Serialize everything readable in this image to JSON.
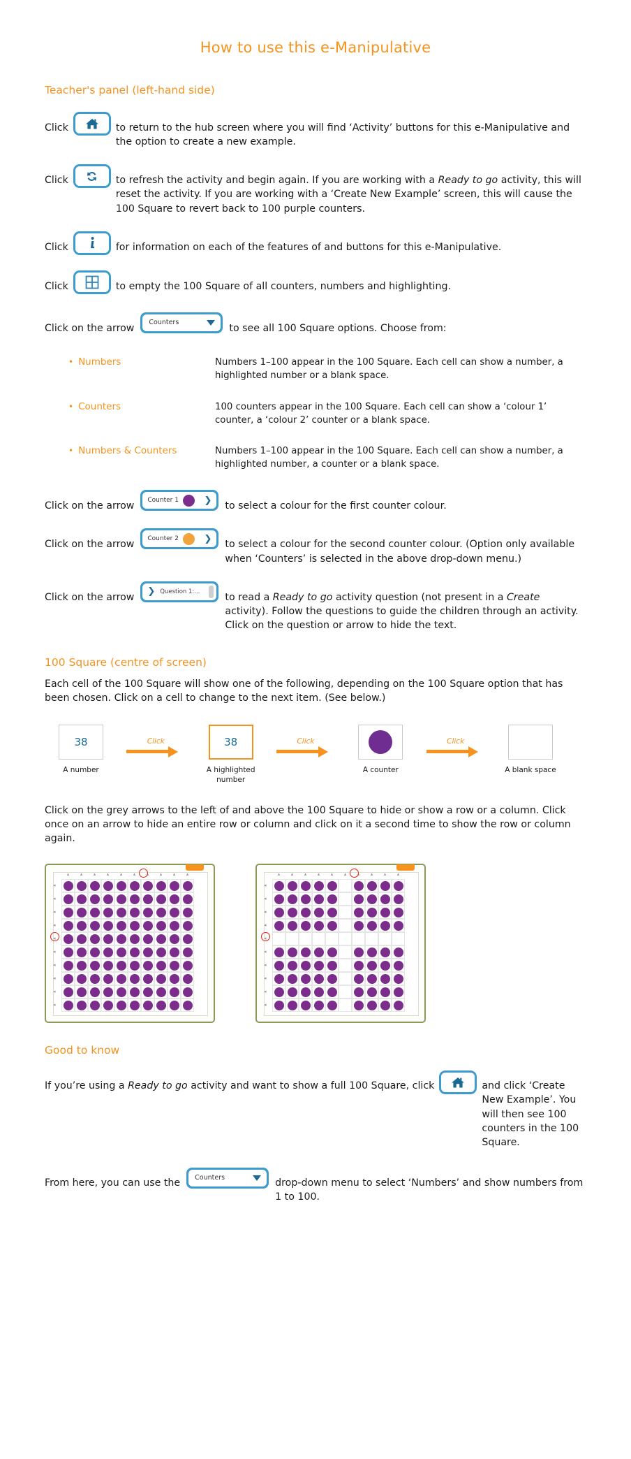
{
  "title": "How to use this e-Manipulative",
  "sections": {
    "teacher_panel": "Teacher's panel (left-hand side)",
    "hundred_square": "100 Square (centre of screen)",
    "good_to_know": "Good to know"
  },
  "colors": {
    "accent_orange": "#f6921e",
    "button_blue": "#3d9ccd",
    "icon_blue": "#1b6a96",
    "counter_purple": "#7c2d8c",
    "counter_orange": "#f2a33c",
    "highlight_red": "#e2231a"
  },
  "rows": {
    "home": {
      "lead": "Click",
      "icon": "home-icon",
      "after": "to return to the hub screen where you will find ‘Activity’ buttons for this e-Manipulative and the option to create a new example."
    },
    "refresh": {
      "lead": "Click",
      "icon": "refresh-icon",
      "after_1": "to refresh the activity and begin again. If you are working with a ",
      "after_em": "Ready to go",
      "after_2": " activity, this will reset the activity. If you are working with a ‘Create New Example’ screen, this will cause the 100 Square to revert back to 100 purple counters."
    },
    "info": {
      "lead": "Click",
      "icon": "info-icon",
      "after": "for information on each of the features of and buttons for this e-Manipulative."
    },
    "empty": {
      "lead": "Click",
      "icon": "grid-icon",
      "after": "to empty the 100 Square of all counters, numbers and highlighting."
    },
    "dropdown": {
      "lead": "Click on the arrow",
      "value": "Counters",
      "after": "to see all 100 Square options. Choose from:"
    },
    "counter1": {
      "lead": "Click on the arrow",
      "label": "Counter 1",
      "after": "to select a colour for the first counter colour."
    },
    "counter2": {
      "lead": "Click on the arrow",
      "label": "Counter 2",
      "after": "to select a colour for the second counter colour. (Option only available when ‘Counters’ is selected in the above drop-down menu.)"
    },
    "question": {
      "lead": "Click on the arrow",
      "label": "Question 1:...",
      "after_1": "to read a ",
      "after_em1": "Ready to go",
      "after_2": " activity question (not present in a ",
      "after_em2": "Create",
      "after_3": " activity). Follow the questions to guide the children through an activity. Click on the question or arrow to hide the text."
    }
  },
  "options": [
    {
      "label": "Numbers",
      "desc": "Numbers 1–100 appear in the 100 Square. Each cell can show a number, a highlighted number or a blank space."
    },
    {
      "label": "Counters",
      "desc": "100 counters appear in the 100 Square. Each cell can show a ‘colour 1’ counter, a ‘colour 2’ counter or a blank space."
    },
    {
      "label": "Numbers & Counters",
      "desc": "Numbers 1–100 appear in the 100 Square. Each cell can show a number, a highlighted number, a counter or a blank space."
    }
  ],
  "hundred_square": {
    "intro": "Each cell of the 100 Square will show one of the following, depending on the 100 Square option that has been chosen. Click on a cell to change to the next item. (See below.)",
    "diagram": {
      "arrow_label": "Click",
      "steps": [
        {
          "value": "38",
          "caption": "A number"
        },
        {
          "value": "38",
          "caption": "A highlighted number"
        },
        {
          "value": "",
          "caption": "A counter"
        },
        {
          "value": "",
          "caption": "A blank space"
        }
      ]
    },
    "arrows_text": "Click on the grey arrows to the left of and above the 100 Square to hide or show a row or a column. Click once on an arrow to hide an entire row or column and click on it a second time to show the row or column again."
  },
  "good_to_know": {
    "line1_a": "If you’re using a ",
    "line1_em": "Ready to go",
    "line1_b": " activity and want to show a full 100 Square, click",
    "line1_c": "and click ‘Create New Example’. You will then see 100 counters in the 100 Square.",
    "line2_a": "From here, you can use the",
    "dropdown_value": "Counters",
    "line2_b": "drop-down menu to select ‘Numbers’ and show numbers from 1 to 100."
  }
}
